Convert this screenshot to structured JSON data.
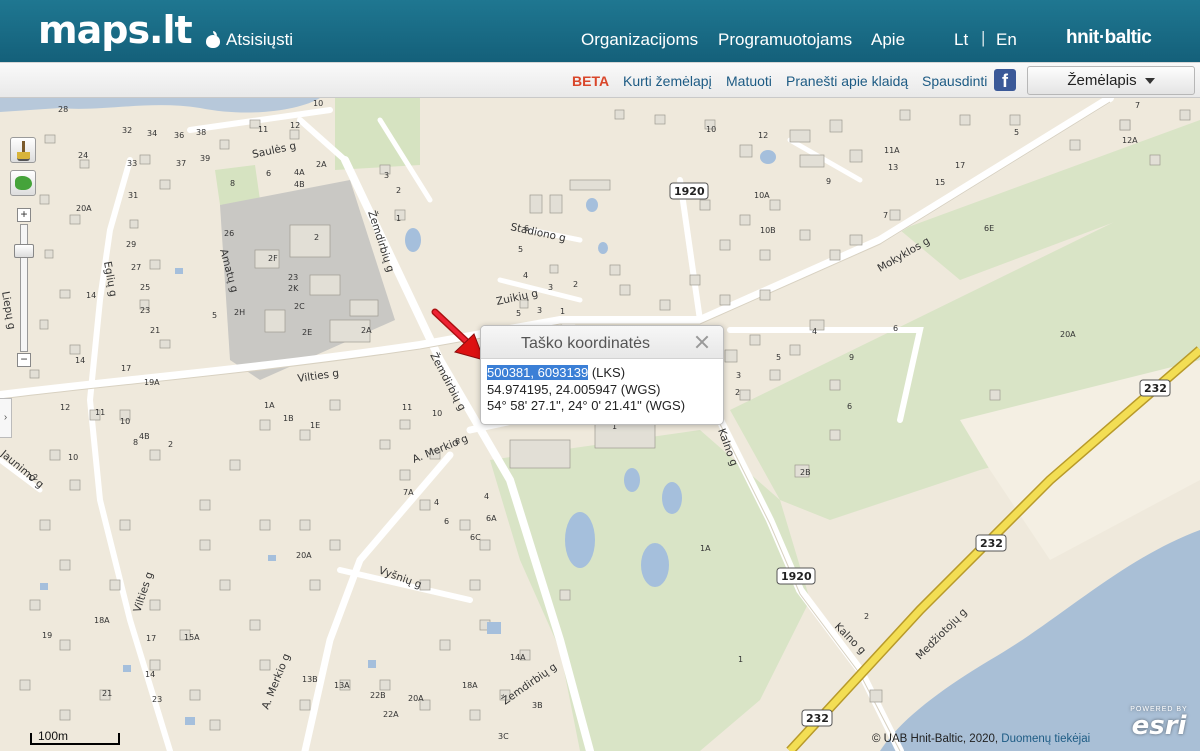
{
  "header": {
    "logo": "maps.lt",
    "download": "Atsisiųsti",
    "nav": [
      "Organizacijoms",
      "Programuotojams",
      "Apie"
    ],
    "lang_lt": "Lt",
    "lang_en": "En",
    "brand": "hnit·baltic"
  },
  "toolbar": {
    "beta": "BETA",
    "create_map": "Kurti žemėlapį",
    "measure": "Matuoti",
    "report_error": "Pranešti apie klaidą",
    "print": "Spausdinti",
    "facebook": "f",
    "layer_select": "Žemėlapis"
  },
  "popup": {
    "title": "Taško koordinatės",
    "lks_value": "500381, 6093139",
    "lks_suffix": " (LKS)",
    "wgs_decimal": "54.974195, 24.005947 (WGS)",
    "wgs_dms": "54° 58' 27.1\", 24° 0' 21.41\" (WGS)"
  },
  "map": {
    "scale": "100m",
    "attribution": "© UAB Hnit-Baltic, 2020,",
    "attribution_link": "Duomenų tiekėjai",
    "esri_powered": "POWERED BY",
    "esri_logo": "esri",
    "streets": {
      "saules": "Saulės g",
      "egliu": "Eglių g",
      "amatu": "Amatų g",
      "zemdirbiu1": "Žemdirbių g",
      "zemdirbiu2": "Žemdirbių g",
      "zemdirbiu3": "Žemdirbių g",
      "stadiono": "Stadiono g",
      "zuikiu": "Zuikių g",
      "vilties1": "Vilties g",
      "vilties2": "Vilties g",
      "merkio1": "A. Merkio g",
      "merkio2": "A. Merkio g",
      "vysniu": "Vyšnių g",
      "mokyklos": "Mokyklos g",
      "kalno1": "Kalno g",
      "kalno2": "Kalno g",
      "medziotoju": "Medžiotojų g",
      "liepu": "Liepų g",
      "jaunimo": "Jaunimo g"
    },
    "shields": [
      "1920",
      "1920",
      "232",
      "232",
      "232"
    ],
    "house_numbers": [
      "28",
      "32",
      "34",
      "36",
      "38",
      "11",
      "10",
      "12",
      "24",
      "33",
      "37",
      "39",
      "6",
      "2A",
      "4A",
      "4B",
      "3",
      "2",
      "20A",
      "31",
      "8",
      "29",
      "27",
      "14",
      "25",
      "23",
      "21",
      "5",
      "26",
      "2F",
      "2H",
      "23",
      "2K",
      "2C",
      "2E",
      "2",
      "1",
      "2A",
      "6",
      "5",
      "4",
      "3",
      "2",
      "5",
      "3",
      "1",
      "19A",
      "17",
      "14",
      "12",
      "11",
      "10",
      "8",
      "1A",
      "1B",
      "1E",
      "4B",
      "2",
      "10",
      "12",
      "20A",
      "7A",
      "6A",
      "6C",
      "4",
      "14A",
      "13B",
      "13A",
      "22B",
      "22A",
      "20A",
      "18A",
      "3B",
      "3C",
      "1920",
      "10",
      "12",
      "10A",
      "10B",
      "9",
      "11A",
      "13",
      "15",
      "17",
      "5",
      "12A",
      "7",
      "7",
      "6E",
      "20A",
      "4",
      "9",
      "6",
      "6",
      "5",
      "3",
      "2",
      "1",
      "2B",
      "1A",
      "1",
      "2",
      "18A",
      "15A",
      "19",
      "17",
      "14",
      "21",
      "23",
      "4",
      "6",
      "8",
      "11",
      "10"
    ]
  }
}
